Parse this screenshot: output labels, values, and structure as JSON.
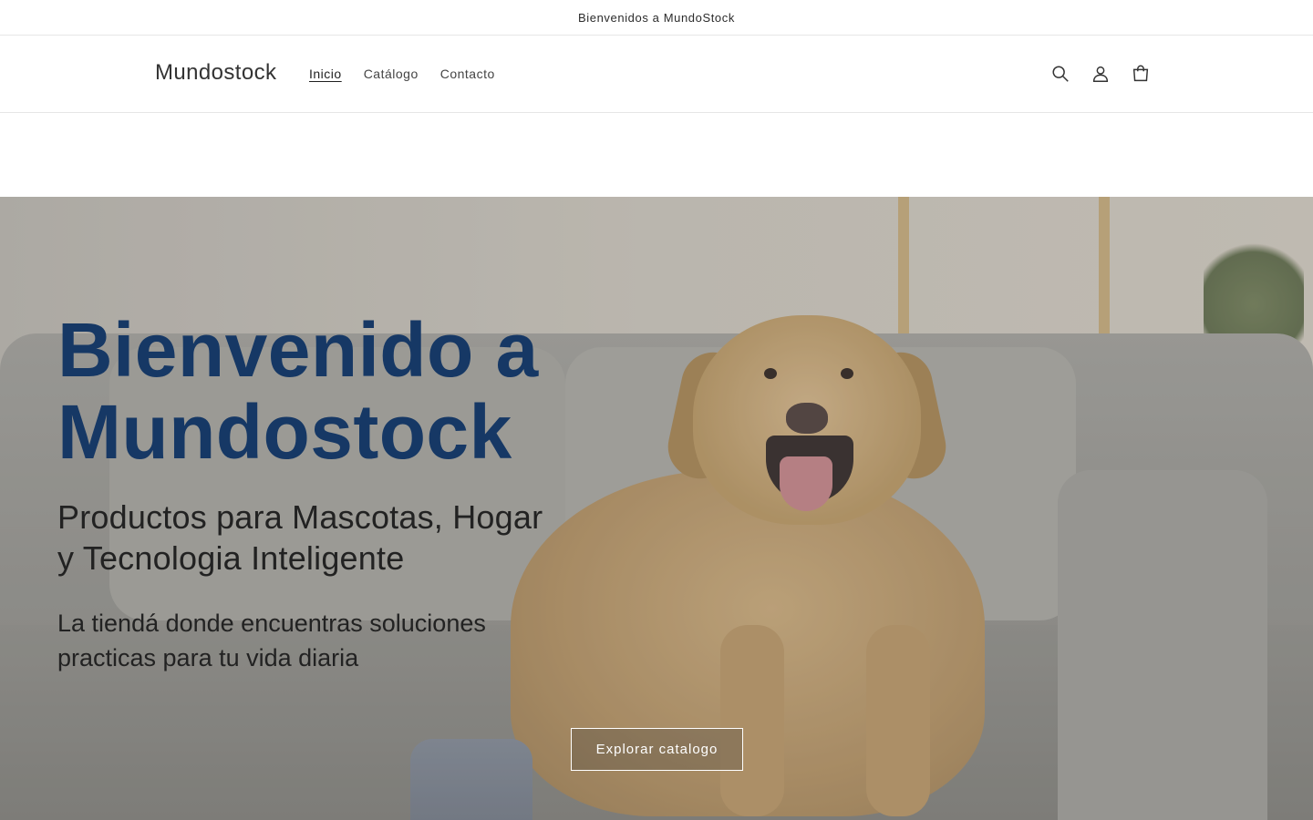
{
  "announcement": {
    "text": "Bienvenidos a MundoStock"
  },
  "header": {
    "logo": "Mundostock",
    "nav": [
      {
        "label": "Inicio",
        "active": true
      },
      {
        "label": "Catálogo",
        "active": false
      },
      {
        "label": "Contacto",
        "active": false
      }
    ],
    "icons": [
      "search-icon",
      "account-icon",
      "cart-icon"
    ]
  },
  "hero": {
    "title_line1": "Bienvenido a",
    "title_line2": "Mundostock",
    "subtitle_line1": "Productos para Mascotas, Hogar",
    "subtitle_line2": "y Tecnologia Inteligente",
    "description_line1": "La tiendá donde encuentras soluciones",
    "description_line2": "practicas para tu vida diaria",
    "cta_label": "Explorar catalogo",
    "title_color": "#163865"
  }
}
